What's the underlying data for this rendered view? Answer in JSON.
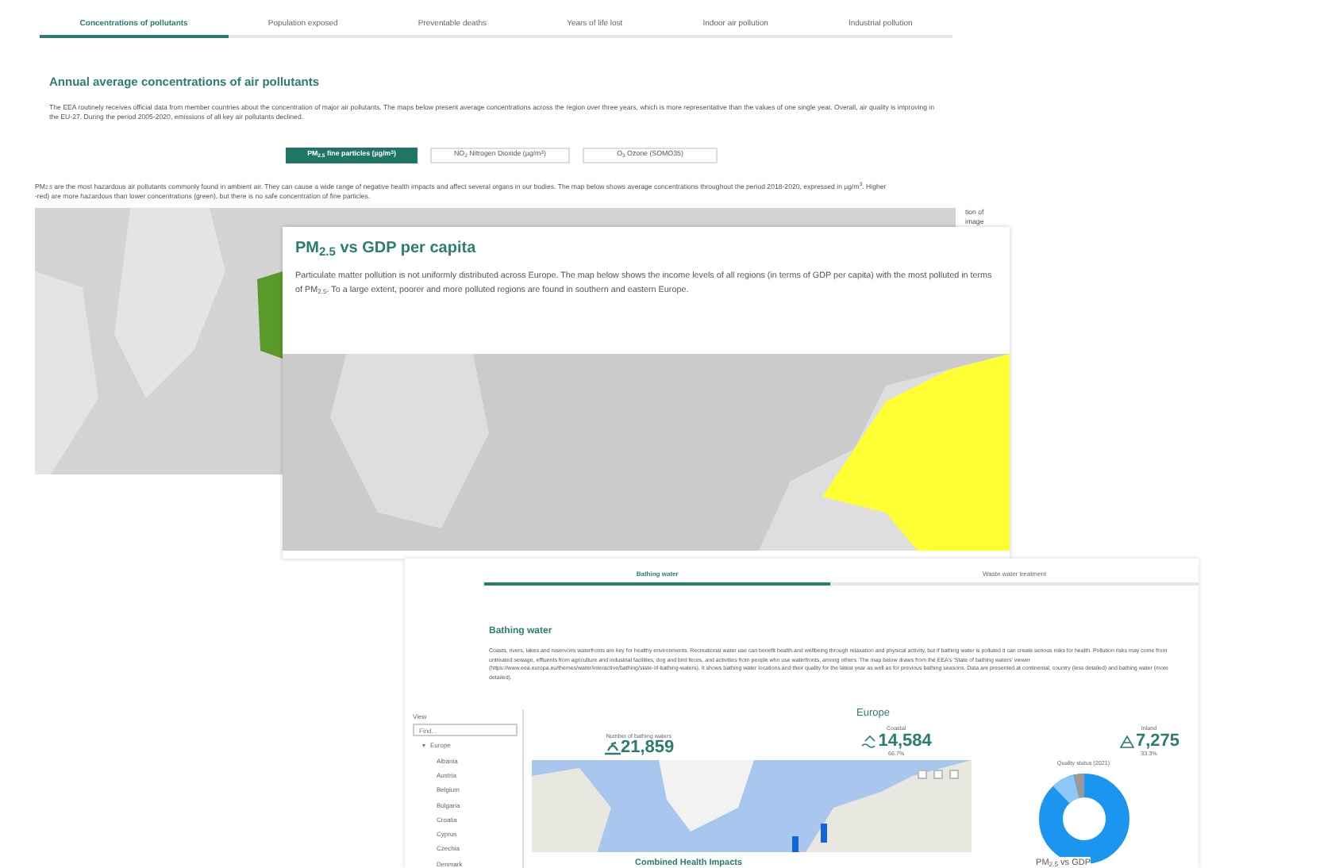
{
  "pollutants_page": {
    "tabs": [
      {
        "label": "Concentrations of pollutants",
        "selected": true
      },
      {
        "label": "Population exposed",
        "selected": false
      },
      {
        "label": "Preventable deaths",
        "selected": false
      },
      {
        "label": "Years of life lost",
        "selected": false
      },
      {
        "label": "Indoor air pollution",
        "selected": false
      },
      {
        "label": "Industrial pollution",
        "selected": false
      }
    ],
    "title": "Annual average concentrations of air pollutants",
    "intro": "The EEA routinely receives official data from member countries about the concentration of major air pollutants. The maps below present average concentrations across the region over three years, which is more representative than the values of one single year. Overall, air quality is improving in the EU-27. During the period 2005-2020, emissions of all key air pollutants declined.",
    "buttons": [
      {
        "label": "PM$_{2.5}$ fine particles (µg/m$^{3}$)",
        "selected": true
      },
      {
        "label": "NO$_{2}$ Nitrogen Dioxide (µg/m$^{3}$)",
        "selected": false
      },
      {
        "label": "O$_{3}$ Ozone (SOMO35)",
        "selected": false
      }
    ],
    "description": [
      "PM$_{2.5}$ are the most hazardous air pollutants commonly found in ambient air. They can cause a wide range of negative health impacts and affect several organs in our bodies. The map below shows average concentrations throughout the period 2018-2020, expressed in µg/m$^{3}$. Higher",
      "-red) are more hazardous than lower concentrations (green), but there is no safe concentration of fine particles."
    ],
    "side_note": [
      "tion of",
      "image"
    ]
  },
  "gdp_page": {
    "title": "PM$_{2.5}$ vs GDP per capita",
    "text": "Particulate matter pollution is not uniformly distributed across Europe. The map below shows the income levels of all regions (in terms of GDP per capita) with the most polluted in terms of PM$_{2.5}$. To a large extent, poorer and more polluted regions are found in southern and eastern Europe."
  },
  "bathing_page": {
    "tabs": [
      {
        "label": "Bathing water",
        "selected": true
      },
      {
        "label": "Waste water treatment",
        "selected": false
      }
    ],
    "title": "Bathing water",
    "text": "Coasts, rivers, lakes and reservoirs waterfronts are key for healthy environments. Recreational water use can benefit health and wellbeing through relaxation and physical activity, but if bathing water is polluted it can create serious risks for health. Pollution risks may come from untreated sewage, effluents from agriculture and industrial facilities, dog and bird feces, and activities from people who use waterfronts, among others. The map below draws from the EEA's 'State of bathing waters' viewer (https://www.eea.europa.eu/themes/water/interactive/bathing/state-of-bathing-waters). It shows bathing water locations and their quality for the latest year as well as for previous bathing seasons. Data are presented at continental, country (less detailed) and bathing water (more detailed).",
    "sidebar": {
      "label": "View",
      "search": {
        "placeholder": "Find..."
      },
      "tree": [
        {
          "label": "Europe",
          "expanded": true,
          "children": [
            {
              "label": "Albania"
            },
            {
              "label": "Austria"
            },
            {
              "label": "Belgium"
            },
            {
              "label": "Bulgaria"
            },
            {
              "label": "Croatia"
            },
            {
              "label": "Cyprus"
            },
            {
              "label": "Czechia"
            },
            {
              "label": "Denmark"
            }
          ]
        }
      ]
    },
    "region_title": "Europe",
    "stats": [
      {
        "kind": "total",
        "label": "Number of bathing waters",
        "value": "21,859"
      },
      {
        "kind": "coastal",
        "label": "Coastal",
        "value": "14,584",
        "share": "66.7%"
      },
      {
        "kind": "inland",
        "label": "Inland",
        "value": "7,275",
        "share": "33.3%"
      }
    ],
    "chart_title": "Quality status (2021)",
    "footer": [
      "Combined Health Impacts",
      "PM$_{2.5}$ vs GDP"
    ]
  }
}
